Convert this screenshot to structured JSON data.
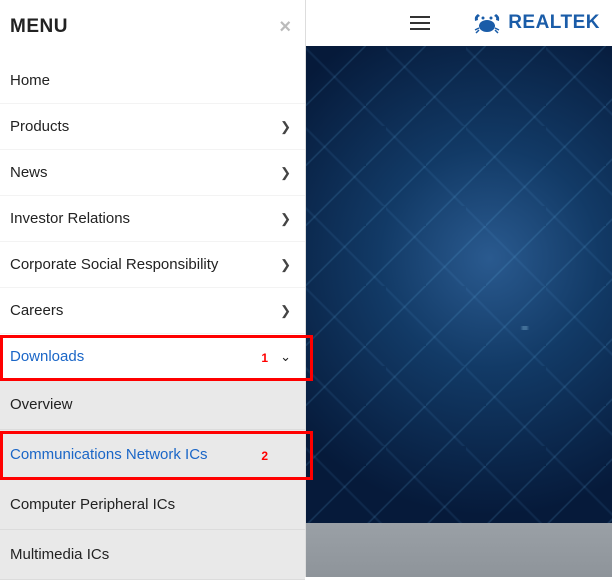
{
  "brand": {
    "name": "REALTEK"
  },
  "menu": {
    "title": "MENU",
    "items": [
      {
        "label": "Home",
        "has_children": false
      },
      {
        "label": "Products",
        "has_children": true
      },
      {
        "label": "News",
        "has_children": true
      },
      {
        "label": "Investor Relations",
        "has_children": true
      },
      {
        "label": "Corporate Social Responsibility",
        "has_children": true
      },
      {
        "label": "Careers",
        "has_children": true
      },
      {
        "label": "Downloads",
        "has_children": true,
        "expanded": true
      }
    ],
    "downloads_submenu": [
      {
        "label": "Overview"
      },
      {
        "label": "Communications Network ICs"
      },
      {
        "label": "Computer Peripheral ICs"
      },
      {
        "label": "Multimedia ICs"
      }
    ]
  },
  "annotations": {
    "box1": "1",
    "box2": "2"
  }
}
